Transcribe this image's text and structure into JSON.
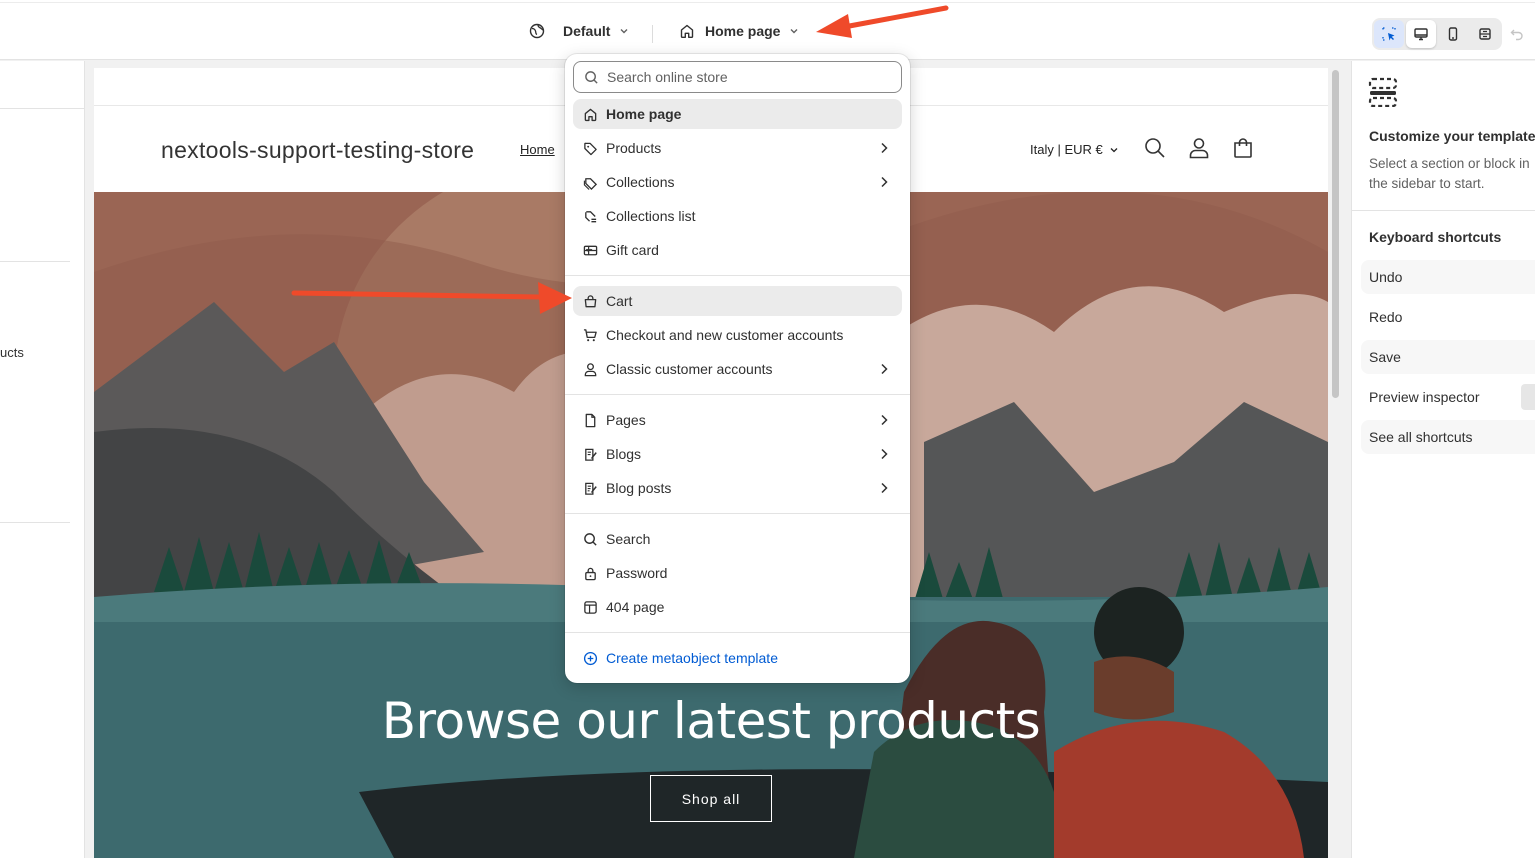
{
  "topbar": {
    "theme_selector": "Default",
    "page_selector": "Home page"
  },
  "left_panel": {
    "partial_text": "ucts"
  },
  "preview": {
    "store_name": "nextools-support-testing-store",
    "nav_home": "Home",
    "locale": "Italy | EUR €",
    "hero_title": "Browse our latest products",
    "hero_button": "Shop all"
  },
  "dropdown": {
    "search_placeholder": "Search online store",
    "groups": [
      [
        {
          "label": "Home page",
          "icon": "home-icon",
          "chevron": false
        },
        {
          "label": "Products",
          "icon": "tag-icon",
          "chevron": true
        },
        {
          "label": "Collections",
          "icon": "collection-icon",
          "chevron": true
        },
        {
          "label": "Collections list",
          "icon": "collection-list-icon",
          "chevron": false
        },
        {
          "label": "Gift card",
          "icon": "gift-card-icon",
          "chevron": false
        }
      ],
      [
        {
          "label": "Cart",
          "icon": "bag-icon",
          "chevron": false
        },
        {
          "label": "Checkout and new customer accounts",
          "icon": "cart-icon",
          "chevron": false
        },
        {
          "label": "Classic customer accounts",
          "icon": "person-icon",
          "chevron": true
        }
      ],
      [
        {
          "label": "Pages",
          "icon": "page-icon",
          "chevron": true
        },
        {
          "label": "Blogs",
          "icon": "blog-icon",
          "chevron": true
        },
        {
          "label": "Blog posts",
          "icon": "blog-post-icon",
          "chevron": true
        }
      ],
      [
        {
          "label": "Search",
          "icon": "search-icon",
          "chevron": false
        },
        {
          "label": "Password",
          "icon": "lock-icon",
          "chevron": false
        },
        {
          "label": "404 page",
          "icon": "error-page-icon",
          "chevron": false
        }
      ]
    ],
    "create_link": "Create metaobject template"
  },
  "right_panel": {
    "title": "Customize your template",
    "description": "Select a section or block in the sidebar to start.",
    "shortcuts_heading": "Keyboard shortcuts",
    "shortcuts": [
      "Undo",
      "Redo",
      "Save",
      "Preview inspector",
      "See all shortcuts"
    ]
  },
  "colors": {
    "accent_link": "#005bd3",
    "annotation_arrow": "#ef4a2a",
    "highlight": "#ebebeb"
  }
}
